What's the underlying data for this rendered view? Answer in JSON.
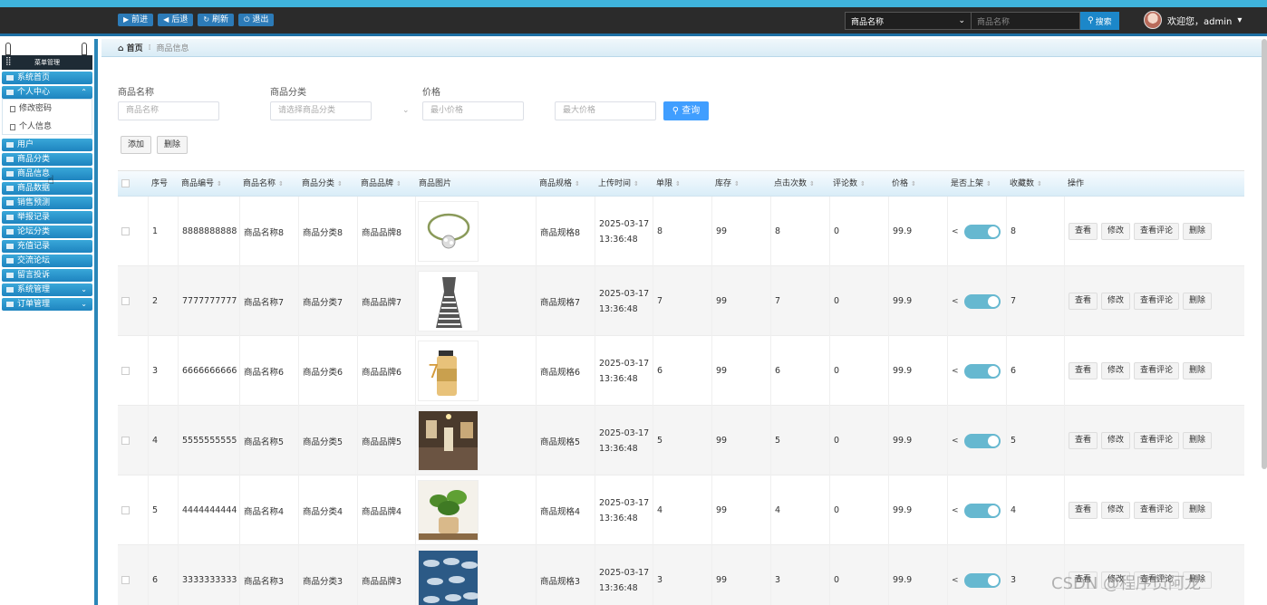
{
  "topbar": {
    "nav": [
      {
        "icon": "play-icon",
        "glyph": "▶",
        "label": "前进"
      },
      {
        "icon": "back-icon",
        "glyph": "◀",
        "label": "后退"
      },
      {
        "icon": "refresh-icon",
        "glyph": "↻",
        "label": "刷新"
      },
      {
        "icon": "power-icon",
        "glyph": "⏻",
        "label": "退出"
      }
    ],
    "search_field": "商品名称",
    "search_placeholder": "商品名称",
    "search_button": "搜索",
    "welcome": "欢迎您，admin"
  },
  "sidebar": {
    "title": "菜单管理",
    "items": [
      {
        "label": "系统首页",
        "chev": ""
      },
      {
        "label": "个人中心",
        "chev": "⌃"
      },
      {
        "label": "用户",
        "chev": ""
      },
      {
        "label": "商品分类",
        "chev": ""
      },
      {
        "label": "商品信息",
        "chev": ""
      },
      {
        "label": "商品数据",
        "chev": ""
      },
      {
        "label": "销售预测",
        "chev": ""
      },
      {
        "label": "举报记录",
        "chev": ""
      },
      {
        "label": "论坛分类",
        "chev": ""
      },
      {
        "label": "充值记录",
        "chev": ""
      },
      {
        "label": "交流论坛",
        "chev": ""
      },
      {
        "label": "留言投诉",
        "chev": ""
      },
      {
        "label": "系统管理",
        "chev": "⌄"
      },
      {
        "label": "订单管理",
        "chev": "⌄"
      }
    ],
    "subitems": [
      "修改密码",
      "个人信息"
    ]
  },
  "breadcrumb": {
    "home": "首页",
    "current": "商品信息"
  },
  "filters": {
    "name_label": "商品名称",
    "name_placeholder": "商品名称",
    "category_label": "商品分类",
    "category_placeholder": "请选择商品分类",
    "price_label": "价格",
    "min_placeholder": "最小价格",
    "max_placeholder": "最大价格",
    "query_button": "查询",
    "add_button": "添加",
    "delete_button": "删除"
  },
  "table": {
    "headers": [
      "序号",
      "商品编号",
      "商品名称",
      "商品分类",
      "商品品牌",
      "商品图片",
      "商品规格",
      "上传时间",
      "单限",
      "库存",
      "点击次数",
      "评论数",
      "价格",
      "是否上架",
      "收藏数",
      "操作"
    ],
    "actions": [
      "查看",
      "修改",
      "查看评论",
      "删除"
    ],
    "rows": [
      {
        "idx": "1",
        "code": "8888888888",
        "name": "商品名称8",
        "category": "商品分类8",
        "brand": "商品品牌8",
        "picture": "bracelet",
        "spec": "商品规格8",
        "time": "2025-03-17 13:36:48",
        "limit": "8",
        "stock": "99",
        "clicks": "8",
        "comments": "0",
        "price": "99.9",
        "favorites": "8"
      },
      {
        "idx": "2",
        "code": "7777777777",
        "name": "商品名称7",
        "category": "商品分类7",
        "brand": "商品品牌7",
        "picture": "dress",
        "spec": "商品规格7",
        "time": "2025-03-17 13:36:48",
        "limit": "7",
        "stock": "99",
        "clicks": "7",
        "comments": "0",
        "price": "99.9",
        "favorites": "7"
      },
      {
        "idx": "3",
        "code": "6666666666",
        "name": "商品名称6",
        "category": "商品分类6",
        "brand": "商品品牌6",
        "picture": "lotion",
        "spec": "商品规格6",
        "time": "2025-03-17 13:36:48",
        "limit": "6",
        "stock": "99",
        "clicks": "6",
        "comments": "0",
        "price": "99.9",
        "favorites": "6"
      },
      {
        "idx": "4",
        "code": "5555555555",
        "name": "商品名称5",
        "category": "商品分类5",
        "brand": "商品品牌5",
        "picture": "shop",
        "spec": "商品规格5",
        "time": "2025-03-17 13:36:48",
        "limit": "5",
        "stock": "99",
        "clicks": "5",
        "comments": "0",
        "price": "99.9",
        "favorites": "5"
      },
      {
        "idx": "5",
        "code": "4444444444",
        "name": "商品名称4",
        "category": "商品分类4",
        "brand": "商品品牌4",
        "picture": "plant",
        "spec": "商品规格4",
        "time": "2025-03-17 13:36:48",
        "limit": "4",
        "stock": "99",
        "clicks": "4",
        "comments": "0",
        "price": "99.9",
        "favorites": "4"
      },
      {
        "idx": "6",
        "code": "3333333333",
        "name": "商品名称3",
        "category": "商品分类3",
        "brand": "商品品牌3",
        "picture": "fish",
        "spec": "商品规格3",
        "time": "2025-03-17 13:36:48",
        "limit": "3",
        "stock": "99",
        "clicks": "3",
        "comments": "0",
        "price": "99.9",
        "favorites": "3"
      }
    ]
  },
  "watermark": "CSDN @程序员阿龙"
}
